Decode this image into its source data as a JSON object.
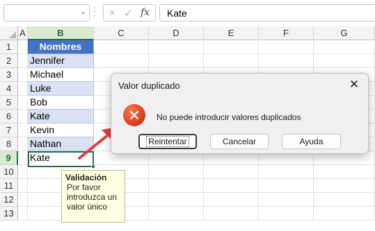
{
  "formula_bar": {
    "name_box": "",
    "cancel_icon": "×",
    "enter_icon": "✓",
    "fx_label": "fx",
    "value": "Kate"
  },
  "columns": [
    "A",
    "B",
    "C",
    "D",
    "E",
    "F",
    "G"
  ],
  "rows": [
    "1",
    "2",
    "3",
    "4",
    "5",
    "6",
    "7",
    "8",
    "9",
    "10",
    "11",
    "12",
    "13"
  ],
  "table": {
    "header": "Nombres",
    "names": [
      "Jennifer",
      "Michael",
      "Luke",
      "Bob",
      "Kate",
      "Kevin",
      "Nathan"
    ],
    "input_cell": "Kate"
  },
  "tooltip": {
    "title": "Validación",
    "body": "Por favor introduzca un valor único"
  },
  "dialog": {
    "title": "Valor duplicado",
    "close": "✕",
    "message": "No puede introducir valores duplicados",
    "buttons": {
      "retry": "Reintentar",
      "cancel": "Cancelar",
      "help": "Ayuda"
    }
  },
  "colors": {
    "header_fill": "#4472c4",
    "band_fill": "#d9e1f2",
    "selection": "#217346",
    "error_icon": "#e0452a",
    "annotation_arrow": "#e8393a",
    "tooltip_fill": "#ffffe1"
  }
}
